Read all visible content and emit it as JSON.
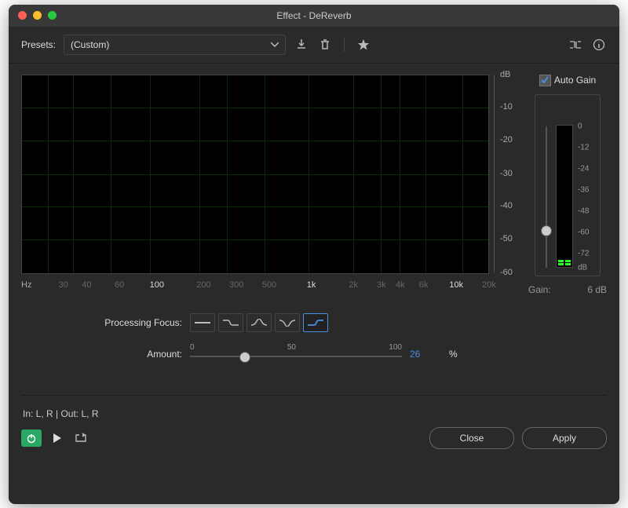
{
  "window": {
    "title": "Effect - DeReverb"
  },
  "presets": {
    "label": "Presets:",
    "value": "(Custom)"
  },
  "chart_data": {
    "type": "spectrum",
    "x_axis": {
      "unit": "Hz",
      "ticks": [
        "30",
        "40",
        "60",
        "100",
        "200",
        "300",
        "500",
        "1k",
        "2k",
        "3k",
        "4k",
        "6k",
        "10k",
        "20k"
      ],
      "scale": "log",
      "range_hz": [
        20,
        20000
      ]
    },
    "y_axis": {
      "unit": "dB",
      "ticks": [
        "dB",
        "-10",
        "-20",
        "-30",
        "-40",
        "-50",
        "-60"
      ],
      "range_db": [
        -60,
        0
      ]
    },
    "series": []
  },
  "processing_focus": {
    "label": "Processing Focus:",
    "options": [
      "low-shelf",
      "low-cut",
      "band",
      "notch",
      "high-shelf"
    ],
    "selected_index": 4
  },
  "amount": {
    "label": "Amount:",
    "min": 0,
    "mid": 50,
    "max": 100,
    "value": 26,
    "unit": "%"
  },
  "auto_gain": {
    "label": "Auto Gain",
    "checked": true
  },
  "meter": {
    "scale": [
      "0",
      "-12",
      "-24",
      "-36",
      "-48",
      "-60",
      "-72",
      "dB"
    ],
    "slider_pos_pct": 74,
    "level_segments": 2
  },
  "gain": {
    "label": "Gain:",
    "value": "6 dB"
  },
  "io": {
    "text": "In: L, R | Out: L, R"
  },
  "buttons": {
    "close": "Close",
    "apply": "Apply"
  }
}
